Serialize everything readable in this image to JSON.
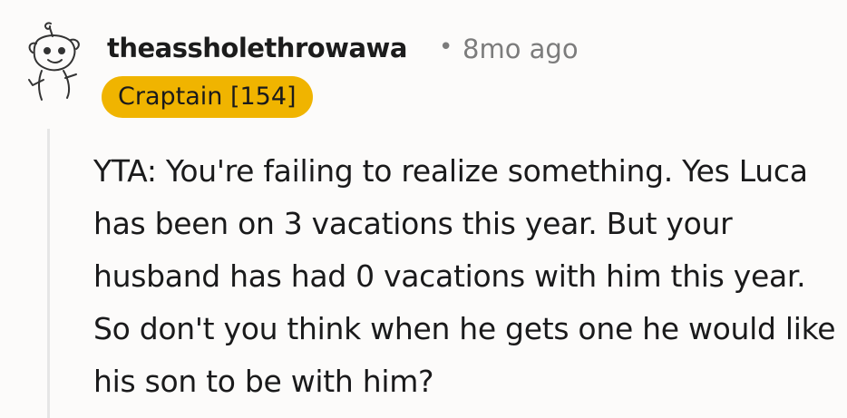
{
  "comment": {
    "username": "theassholethrowawa",
    "separator": "•",
    "timestamp": "8mo ago",
    "flair": "Craptain [154]",
    "flair_color": "#f0b400",
    "avatar_icon": "snoo-avatar-icon",
    "body": "YTA: You're failing to realize something. Yes Luca has been on 3 vacations this year. But your husband has had 0 vacations with him this year. So don't you think when he gets one he would like his son to be with him?"
  }
}
